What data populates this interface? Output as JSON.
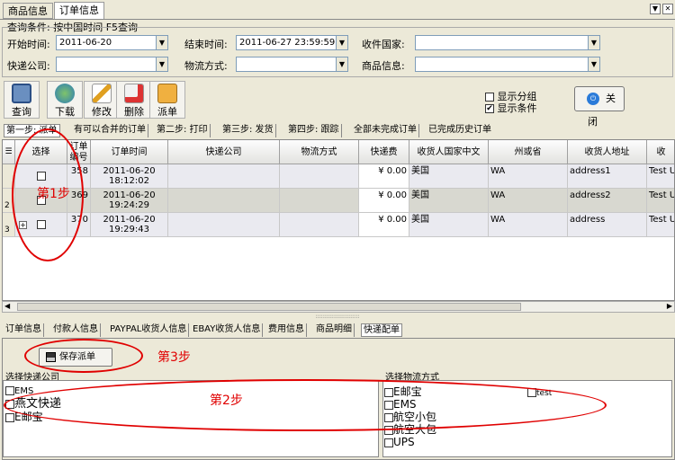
{
  "top_tabs": [
    "商品信息",
    "订单信息"
  ],
  "query": {
    "title": "查询条件: 按中国时间   F5查询",
    "start_label": "开始时间:",
    "start_value": "2011-06-20",
    "end_label": "结束时间:",
    "end_value": "2011-06-27 23:59:59",
    "country_label": "收件国家:",
    "express_label": "快递公司:",
    "logistics_label": "物流方式:",
    "goods_label": "商品信息:"
  },
  "toolbar": {
    "query": "查询",
    "download": "下载",
    "modify": "修改",
    "delete": "删除",
    "dispatch": "派单",
    "show_group": "显示分组",
    "show_condition": "显示条件",
    "close": "关闭"
  },
  "step_tabs": [
    "第一步: 派单",
    "有可以合并的订单",
    "第二步: 打印",
    "第三步: 发货",
    "第四步: 跟踪",
    "全部未完成订单",
    "已完成历史订单"
  ],
  "grid": {
    "headers": [
      "选择",
      "订单编号",
      "订单时间",
      "快递公司",
      "物流方式",
      "快递费",
      "收货人国家中文",
      "州或省",
      "收货人地址",
      "收"
    ],
    "rows": [
      {
        "no": "358",
        "date": "2011-06-20",
        "time": "18:12:02",
        "fee": "¥ 0.00",
        "country": "美国",
        "state": "WA",
        "addr": "address1",
        "extra": "Test U"
      },
      {
        "no": "369",
        "date": "2011-06-20",
        "time": "19:24:29",
        "fee": "¥ 0.00",
        "country": "美国",
        "state": "WA",
        "addr": "address2",
        "extra": "Test U"
      },
      {
        "no": "370",
        "date": "2011-06-20",
        "time": "19:29:43",
        "fee": "¥ 0.00",
        "country": "美国",
        "state": "WA",
        "addr": "address",
        "extra": "Test U"
      }
    ],
    "row_markers": [
      "2",
      "3"
    ]
  },
  "bottom_tabs": [
    "订单信息",
    "付款人信息",
    "PAYPAL收货人信息",
    "EBAY收货人信息",
    "费用信息",
    "商品明细",
    "快递配单"
  ],
  "save_label": "保存派单",
  "express_group": {
    "title": "选择快递公司",
    "items": [
      "EMS",
      "燕文快递",
      "E邮宝"
    ]
  },
  "logistics_group": {
    "title": "选择物流方式",
    "items": [
      "E邮宝",
      "EMS",
      "航空小包",
      "航空大包",
      "UPS"
    ],
    "extra": "test"
  },
  "annotations": {
    "step1": "第1步",
    "step2": "第2步",
    "step3": "第3步"
  },
  "window_buttons": [
    "▼",
    "✕"
  ],
  "colors": {
    "annotation": "#e00000",
    "active_tab": "#ffffff",
    "grid_header": "#e3e3e0"
  }
}
